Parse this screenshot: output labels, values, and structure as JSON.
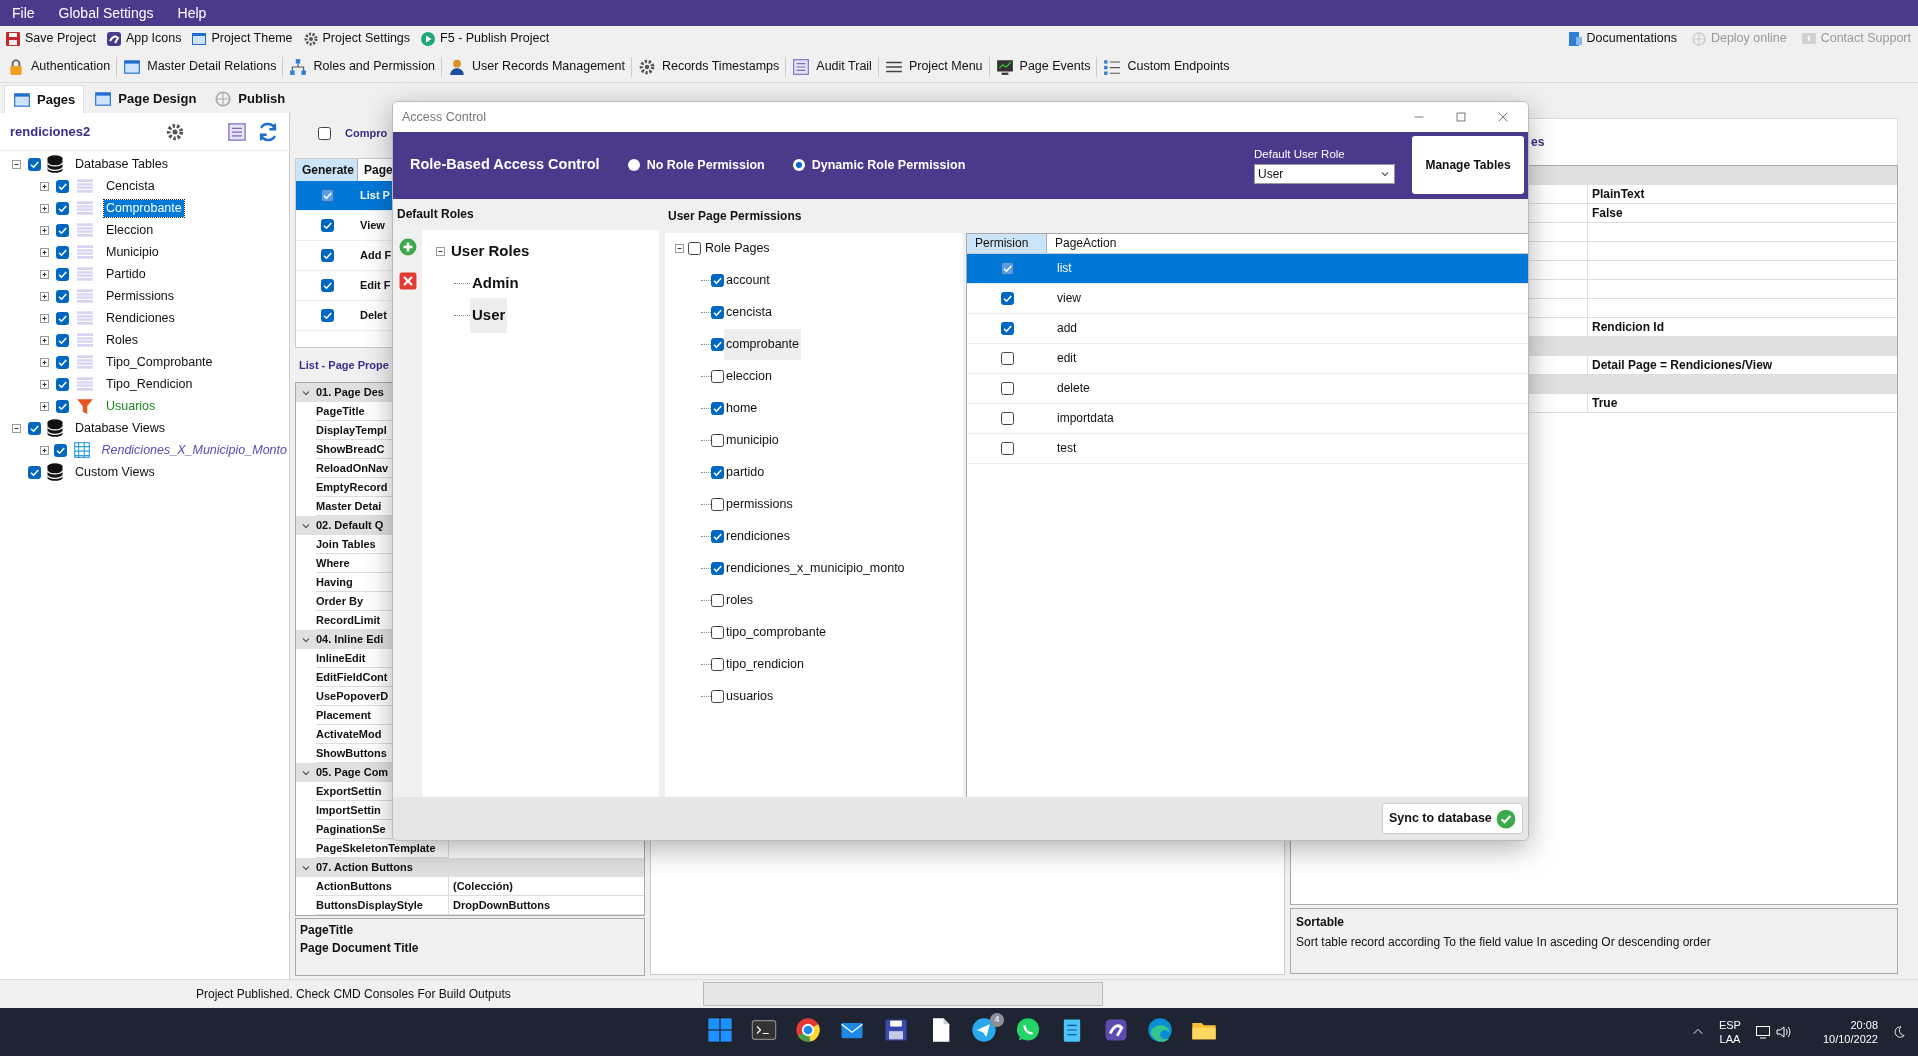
{
  "menu": [
    "File",
    "Global Settings",
    "Help"
  ],
  "toolbar": {
    "left": [
      {
        "label": "Save Project",
        "disabled": false
      },
      {
        "label": "App Icons",
        "disabled": false
      },
      {
        "label": "Project Theme",
        "disabled": false
      },
      {
        "label": "Project Settings",
        "disabled": false
      },
      {
        "label": "F5 - Publish Project",
        "disabled": false
      }
    ],
    "right": [
      {
        "label": "Documentations",
        "disabled": false
      },
      {
        "label": "Deploy online",
        "disabled": true
      },
      {
        "label": "Contact Support",
        "disabled": true
      }
    ]
  },
  "ribbon": [
    "Authentication",
    "Master Detail Relations",
    "Roles and Permission",
    "User Records Management",
    "Records Timestamps",
    "Audit Trail",
    "Project Menu",
    "Page Events",
    "Custom Endpoints"
  ],
  "tabs": [
    {
      "label": "Pages",
      "selected": true
    },
    {
      "label": "Page Design",
      "selected": false
    },
    {
      "label": "Publish",
      "selected": false
    }
  ],
  "explorer": {
    "title": "rendiciones2",
    "tree": [
      {
        "label": "Database Tables",
        "kind": "database",
        "checked": true,
        "expanded": true,
        "selected": false,
        "children": [
          {
            "label": "Cencista",
            "kind": "table",
            "checked": true,
            "expanded": false,
            "selected": false
          },
          {
            "label": "Comprobante",
            "kind": "table",
            "checked": true,
            "expanded": false,
            "selected": true
          },
          {
            "label": "Eleccion",
            "kind": "table",
            "checked": true,
            "expanded": false,
            "selected": false
          },
          {
            "label": "Municipio",
            "kind": "table",
            "checked": true,
            "expanded": false,
            "selected": false
          },
          {
            "label": "Partido",
            "kind": "table",
            "checked": true,
            "expanded": false,
            "selected": false
          },
          {
            "label": "Permissions",
            "kind": "table",
            "checked": true,
            "expanded": false,
            "selected": false
          },
          {
            "label": "Rendiciones",
            "kind": "table",
            "checked": true,
            "expanded": false,
            "selected": false
          },
          {
            "label": "Roles",
            "kind": "table",
            "checked": true,
            "expanded": false,
            "selected": false
          },
          {
            "label": "Tipo_Comprobante",
            "kind": "table",
            "checked": true,
            "expanded": false,
            "selected": false
          },
          {
            "label": "Tipo_Rendicion",
            "kind": "table",
            "checked": true,
            "expanded": false,
            "selected": false
          },
          {
            "label": "Usuarios",
            "kind": "filtered",
            "checked": true,
            "expanded": false,
            "selected": false
          }
        ]
      },
      {
        "label": "Database Views",
        "kind": "database",
        "checked": true,
        "expanded": true,
        "selected": false,
        "children": [
          {
            "label": "Rendiciones_X_Municipio_Monto",
            "kind": "view",
            "checked": true,
            "expanded": false,
            "selected": false
          }
        ]
      },
      {
        "label": "Custom Views",
        "kind": "database",
        "checked": true,
        "selected": false
      }
    ]
  },
  "pages_panel": {
    "header": {
      "label": "Compro",
      "checked": false
    },
    "columns": [
      "Generate",
      "Page"
    ],
    "rows": [
      {
        "label": "List P",
        "checked": true,
        "selected": true
      },
      {
        "label": "View",
        "checked": true,
        "selected": false
      },
      {
        "label": "Add F",
        "checked": true,
        "selected": false
      },
      {
        "label": "Edit F",
        "checked": true,
        "selected": false
      },
      {
        "label": "Delet",
        "checked": true,
        "selected": false
      }
    ],
    "properties_title": "List - Page Prope",
    "properties": [
      {
        "kind": "category",
        "name": "01. Page Des"
      },
      {
        "kind": "property",
        "name": "PageTitle"
      },
      {
        "kind": "property",
        "name": "DisplayTempl"
      },
      {
        "kind": "property",
        "name": "ShowBreadC"
      },
      {
        "kind": "property",
        "name": "ReloadOnNav"
      },
      {
        "kind": "property",
        "name": "EmptyRecord"
      },
      {
        "kind": "property",
        "name": "Master Detai"
      },
      {
        "kind": "category",
        "name": "02. Default Q"
      },
      {
        "kind": "property",
        "name": "Join Tables"
      },
      {
        "kind": "property",
        "name": "Where"
      },
      {
        "kind": "property",
        "name": "Having"
      },
      {
        "kind": "property",
        "name": "Order By"
      },
      {
        "kind": "property",
        "name": "RecordLimit"
      },
      {
        "kind": "category",
        "name": "04. Inline Edi"
      },
      {
        "kind": "property",
        "name": "InlineEdit"
      },
      {
        "kind": "property",
        "name": "EditFieldCont"
      },
      {
        "kind": "property",
        "name": "UsePopoverD"
      },
      {
        "kind": "property",
        "name": "Placement"
      },
      {
        "kind": "property",
        "name": "ActivateMod"
      },
      {
        "kind": "property",
        "name": "ShowButtons"
      },
      {
        "kind": "category",
        "name": "05. Page Com"
      },
      {
        "kind": "property",
        "name": "ExportSettin"
      },
      {
        "kind": "property",
        "name": "ImportSettin"
      },
      {
        "kind": "property",
        "name": "PaginationSe"
      },
      {
        "kind": "property",
        "name": "PageSkeletonTemplate"
      },
      {
        "kind": "category",
        "name": "07. Action Buttons"
      },
      {
        "kind": "property",
        "name": "ActionButtons",
        "value": "(Colección)"
      },
      {
        "kind": "property",
        "name": "ButtonsDisplayStyle",
        "value": "DropDownButtons"
      }
    ],
    "description": {
      "title": "PageTitle",
      "text": "Page Document Title"
    }
  },
  "fields_panel": {
    "title": "es",
    "rows": [
      {
        "kind": "category"
      },
      {
        "kind": "property",
        "value": "PlainText"
      },
      {
        "kind": "property",
        "value": "False"
      },
      {
        "kind": "property"
      },
      {
        "kind": "property"
      },
      {
        "kind": "property"
      },
      {
        "kind": "property"
      },
      {
        "kind": "property"
      },
      {
        "kind": "property",
        "value": "Rendicion Id"
      },
      {
        "kind": "category"
      },
      {
        "kind": "property",
        "value": "Detail Page = Rendiciones/View"
      },
      {
        "kind": "category"
      },
      {
        "kind": "property",
        "value": "True"
      }
    ],
    "description": {
      "title": "Sortable",
      "text": "Sort table record according To the field value In asceding Or descending order"
    }
  },
  "dialog": {
    "title": "Access Control",
    "heading": "Role-Based Access Control",
    "modes": [
      {
        "label": "No Role Permission",
        "selected": false
      },
      {
        "label": "Dynamic Role Permission",
        "selected": true
      }
    ],
    "default_role": {
      "label": "Default User Role",
      "value": "User"
    },
    "manage_button": "Manage Tables",
    "roles_label": "Default Roles",
    "roles": {
      "label": "User Roles",
      "expanded": true,
      "children": [
        {
          "label": "Admin",
          "selected": false
        },
        {
          "label": "User",
          "selected": true
        }
      ]
    },
    "permissions_label": "User Page Permissions",
    "pages": {
      "label": "Role Pages",
      "checked": false,
      "expanded": true,
      "children": [
        {
          "label": "account",
          "checked": true,
          "selected": false
        },
        {
          "label": "cencista",
          "checked": true,
          "selected": false
        },
        {
          "label": "comprobante",
          "checked": true,
          "selected": true
        },
        {
          "label": "eleccion",
          "checked": false,
          "selected": false
        },
        {
          "label": "home",
          "checked": true,
          "selected": false
        },
        {
          "label": "municipio",
          "checked": false,
          "selected": false
        },
        {
          "label": "partido",
          "checked": true,
          "selected": false
        },
        {
          "label": "permissions",
          "checked": false,
          "selected": false
        },
        {
          "label": "rendiciones",
          "checked": true,
          "selected": false
        },
        {
          "label": "rendiciones_x_municipio_monto",
          "checked": true,
          "selected": false
        },
        {
          "label": "roles",
          "checked": false,
          "selected": false
        },
        {
          "label": "tipo_comprobante",
          "checked": false,
          "selected": false
        },
        {
          "label": "tipo_rendicion",
          "checked": false,
          "selected": false
        },
        {
          "label": "usuarios",
          "checked": false,
          "selected": false
        }
      ]
    },
    "actions": {
      "columns": [
        "Permision",
        "PageAction"
      ],
      "rows": [
        {
          "action": "list",
          "checked": true,
          "selected": true
        },
        {
          "action": "view",
          "checked": true,
          "selected": false
        },
        {
          "action": "add",
          "checked": true,
          "selected": false
        },
        {
          "action": "edit",
          "checked": false,
          "selected": false
        },
        {
          "action": "delete",
          "checked": false,
          "selected": false
        },
        {
          "action": "importdata",
          "checked": false,
          "selected": false
        },
        {
          "action": "test",
          "checked": false,
          "selected": false
        }
      ]
    },
    "sync_button": "Sync to database"
  },
  "status_bar": {
    "message": "Project Published. Check CMD Consoles For Build Outputs",
    "level": 0
  },
  "taskbar": {
    "badge": "4",
    "language": "ESP",
    "layout": "LAA",
    "time": "20:08",
    "date": "10/10/2022"
  }
}
